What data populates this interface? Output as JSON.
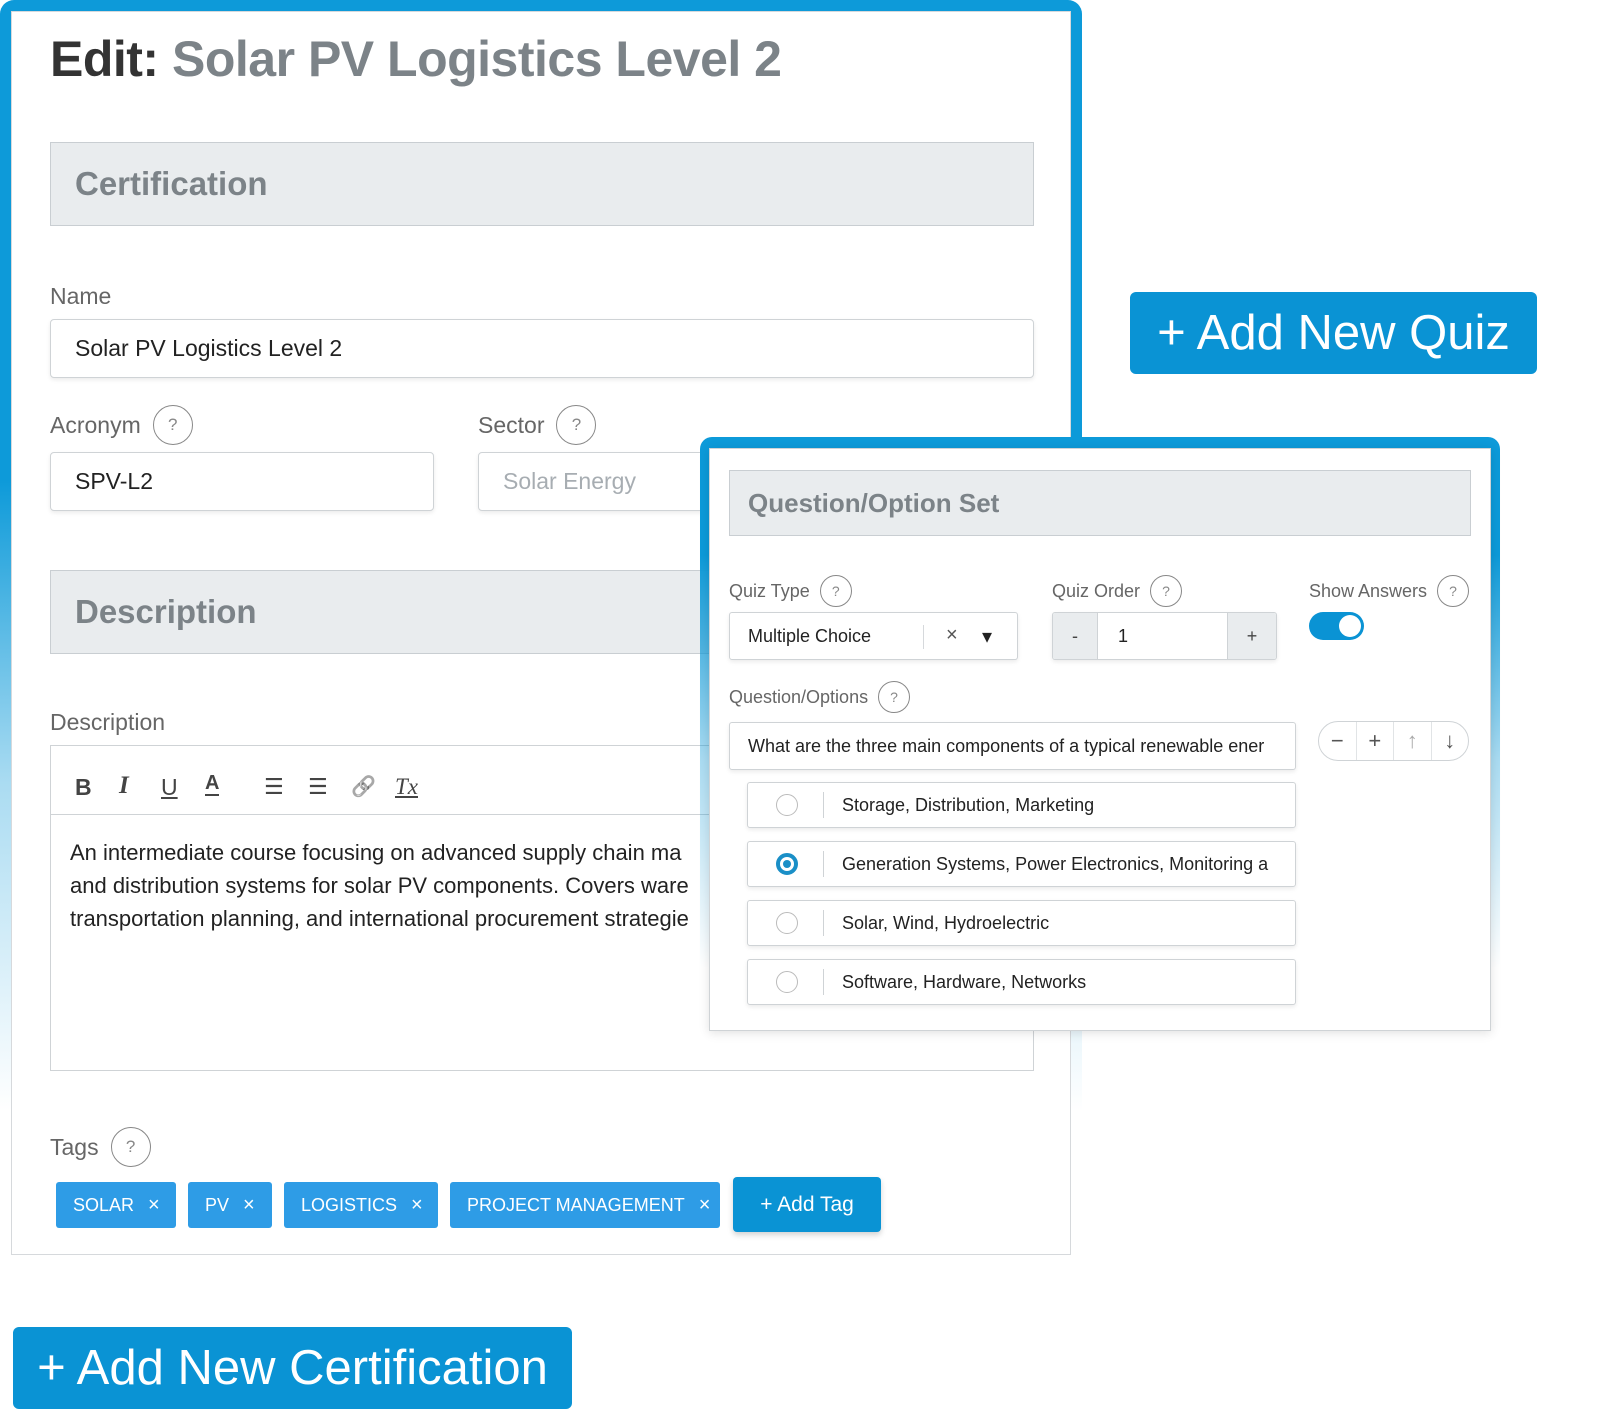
{
  "certification_form": {
    "title_prefix": "Edit:",
    "title_name": "Solar PV Logistics Level 2",
    "section_certification": "Certification",
    "name_label": "Name",
    "name_value": "Solar PV Logistics Level 2",
    "acronym_label": "Acronym",
    "acronym_value": "SPV-L2",
    "sector_label": "Sector",
    "sector_placeholder": "Solar Energy",
    "help_glyph": "?",
    "section_description": "Description",
    "description_label": "Description",
    "toolbar": {
      "bold": "B",
      "italic": "I",
      "underline": "U",
      "font_color": "A",
      "ordered_list": "☰",
      "bullet_list": "☰",
      "link": "🔗",
      "clear_format": "Tx"
    },
    "description_lines": [
      "An intermediate course focusing on advanced supply chain ma",
      "and distribution systems for solar PV components. Covers ware",
      "transportation planning, and international procurement strategie"
    ],
    "tags_label": "Tags",
    "tags": [
      "SOLAR",
      "PV",
      "LOGISTICS",
      "PROJECT MANAGEMENT"
    ],
    "tag_remove_glyph": "×",
    "add_tag_label": "+ Add Tag"
  },
  "quiz_form": {
    "section_title": "Question/Option Set",
    "quiz_type_label": "Quiz Type",
    "quiz_type_value": "Multiple Choice",
    "clear_glyph": "×",
    "dropdown_glyph": "▾",
    "quiz_order_label": "Quiz Order",
    "quiz_order_value": "1",
    "decrement_glyph": "-",
    "increment_glyph": "+",
    "show_answers_label": "Show Answers",
    "show_answers_on": true,
    "question_options_label": "Question/Options",
    "question_text": "What are the three main components of a typical renewable ener",
    "controls": {
      "remove": "−",
      "add": "+",
      "move_up": "↑",
      "move_down": "↓"
    },
    "options": [
      {
        "text": "Storage, Distribution, Marketing",
        "selected": false
      },
      {
        "text": "Generation Systems, Power Electronics, Monitoring a",
        "selected": true
      },
      {
        "text": "Solar, Wind, Hydroelectric",
        "selected": false
      },
      {
        "text": "Software, Hardware, Networks",
        "selected": false
      }
    ]
  },
  "actions": {
    "add_new_quiz": "+ Add New Quiz",
    "add_new_certification": "+ Add New Certification"
  },
  "colors": {
    "accent": "#0a93d4",
    "tag": "#2e9ce6",
    "section_bg": "#e9ecee",
    "title_gray": "#7c8388"
  }
}
